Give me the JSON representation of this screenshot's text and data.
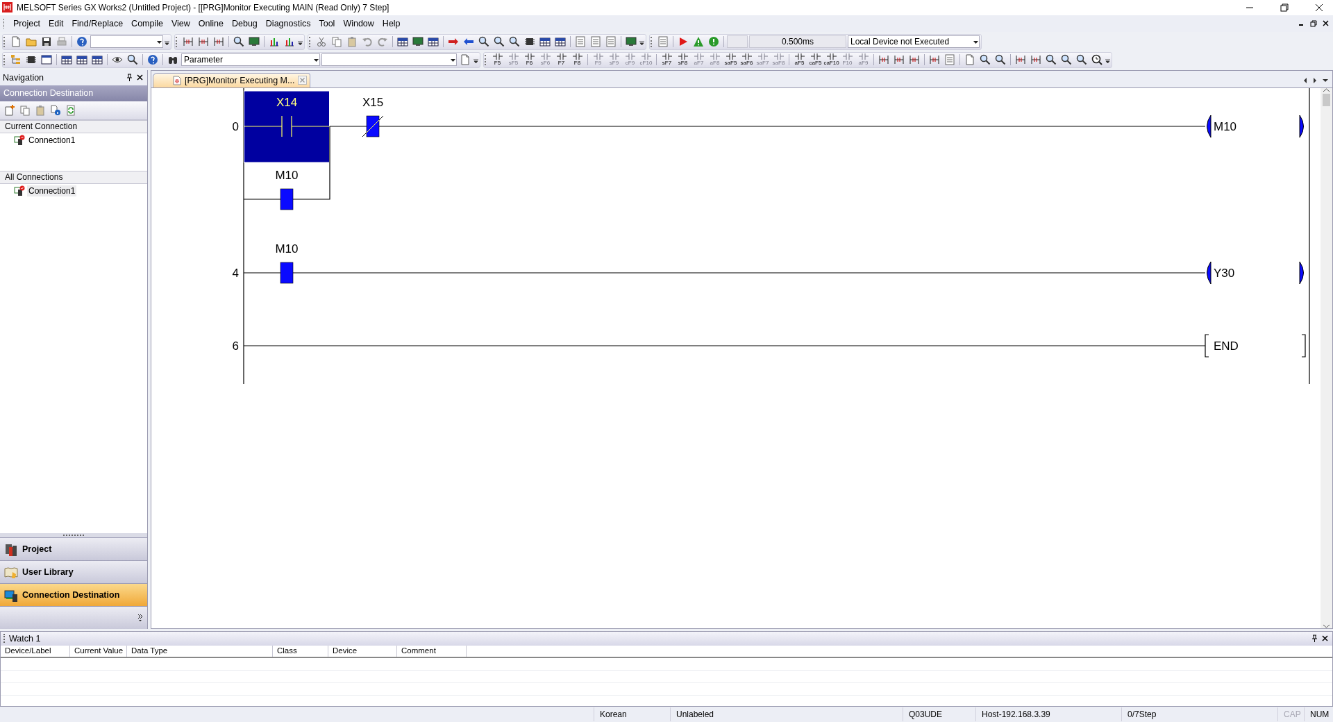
{
  "window": {
    "title": "MELSOFT Series GX Works2 (Untitled Project) - [[PRG]Monitor Executing MAIN (Read Only) 7 Step]"
  },
  "menu": [
    "Project",
    "Edit",
    "Find/Replace",
    "Compile",
    "View",
    "Online",
    "Debug",
    "Diagnostics",
    "Tool",
    "Window",
    "Help"
  ],
  "toolbar": {
    "cycle_time": "0.500ms",
    "device_status": "Local Device not Executed",
    "parameter": "Parameter"
  },
  "ladder_tools": [
    {
      "key": "F5",
      "disabled": false
    },
    {
      "key": "sF5",
      "disabled": true
    },
    {
      "key": "F6",
      "disabled": false
    },
    {
      "key": "sF6",
      "disabled": true
    },
    {
      "key": "F7",
      "disabled": false
    },
    {
      "key": "F8",
      "disabled": false
    },
    {
      "key": "F9",
      "disabled": true
    },
    {
      "key": "sF9",
      "disabled": true
    },
    {
      "key": "cF9",
      "disabled": true
    },
    {
      "key": "cF10",
      "disabled": true
    },
    {
      "key": "sF7",
      "disabled": false
    },
    {
      "key": "sF8",
      "disabled": false
    },
    {
      "key": "aF7",
      "disabled": true
    },
    {
      "key": "aF8",
      "disabled": true
    },
    {
      "key": "saF5",
      "disabled": false
    },
    {
      "key": "saF6",
      "disabled": false
    },
    {
      "key": "saF7",
      "disabled": true
    },
    {
      "key": "saF8",
      "disabled": true
    },
    {
      "key": "aF5",
      "disabled": false
    },
    {
      "key": "caF5",
      "disabled": false
    },
    {
      "key": "caF10",
      "disabled": false
    },
    {
      "key": "F10",
      "disabled": true
    },
    {
      "key": "aF9",
      "disabled": true
    }
  ],
  "navigation": {
    "title": "Navigation",
    "section": "Connection Destination",
    "current_connection": {
      "label": "Current Connection",
      "items": [
        {
          "label": "Connection1",
          "selected": false
        }
      ]
    },
    "all_connections": {
      "label": "All Connections",
      "items": [
        {
          "label": "Connection1",
          "selected": true
        }
      ]
    },
    "panels": [
      {
        "label": "Project",
        "selected": false
      },
      {
        "label": "User Library",
        "selected": false
      },
      {
        "label": "Connection Destination",
        "selected": true
      }
    ]
  },
  "editor": {
    "tab": {
      "label": "[PRG]Monitor Executing M...",
      "selected": true
    },
    "rungs": [
      {
        "step": "0",
        "contacts": [
          {
            "device": "X14",
            "kind": "no",
            "selected": true
          },
          {
            "device": "X15",
            "kind": "nc",
            "on": true
          }
        ],
        "branch": [
          {
            "device": "M10",
            "kind": "no",
            "on": true
          }
        ],
        "coil": {
          "device": "M10",
          "kind": "out",
          "on": true
        }
      },
      {
        "step": "4",
        "contacts": [
          {
            "device": "M10",
            "kind": "no",
            "on": true
          }
        ],
        "coil": {
          "device": "Y30",
          "kind": "out",
          "on": true
        }
      },
      {
        "step": "6",
        "coil": {
          "device": "END",
          "kind": "end"
        }
      }
    ]
  },
  "watch": {
    "title": "Watch 1",
    "columns": [
      "Device/Label",
      "Current Value",
      "Data Type",
      "Class",
      "Device",
      "Comment"
    ]
  },
  "status_bar": [
    {
      "text": "Korean",
      "disabled": false
    },
    {
      "text": "Unlabeled",
      "disabled": false
    },
    {
      "text": "Q03UDE",
      "disabled": false
    },
    {
      "text": "Host-192.168.3.39",
      "disabled": false
    },
    {
      "text": "0/7Step",
      "disabled": false
    },
    {
      "text": "CAP",
      "disabled": true
    },
    {
      "text": "NUM",
      "disabled": false
    }
  ]
}
